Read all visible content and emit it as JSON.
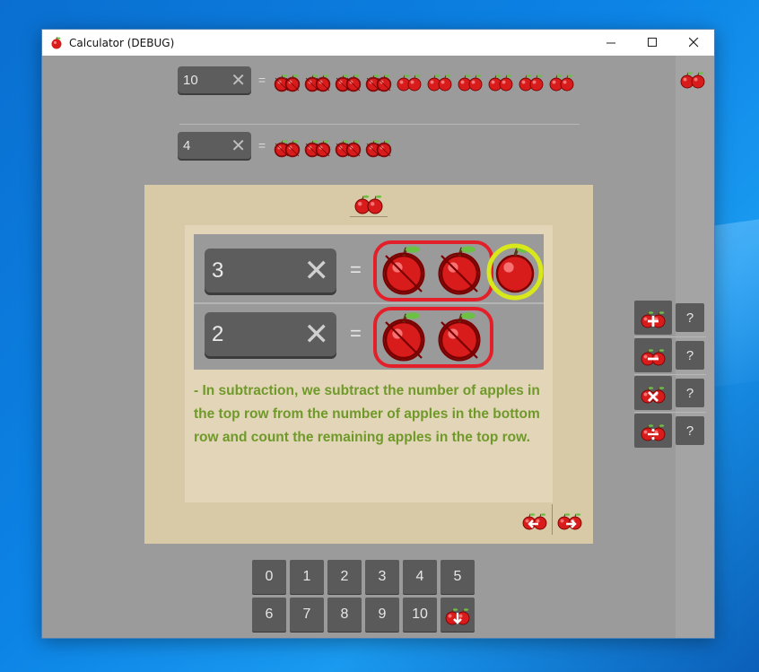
{
  "window": {
    "title": "Calculator (DEBUG)"
  },
  "top_rows": [
    {
      "value": "10",
      "apples": 10,
      "crossed": 4
    },
    {
      "value": "4",
      "apples": 4,
      "crossed": 4
    }
  ],
  "example": {
    "rows": [
      {
        "value": "3",
        "apples": 3,
        "crossed": 2
      },
      {
        "value": "2",
        "apples": 2,
        "crossed": 2
      }
    ],
    "equals": "=",
    "explanation": "- In subtraction, we subtract the number of apples in the top row from the number of apples in the bottom row and count the remaining apples in the top row."
  },
  "equals_sign": "=",
  "keypad": {
    "keys": [
      "0",
      "1",
      "2",
      "3",
      "4",
      "5",
      "6",
      "7",
      "8",
      "9",
      "10"
    ]
  },
  "operations": [
    {
      "name": "add",
      "help": "?"
    },
    {
      "name": "subtract",
      "help": "?"
    },
    {
      "name": "multiply",
      "help": "?"
    },
    {
      "name": "divide",
      "help": "?"
    }
  ],
  "colors": {
    "apple_red": "#d81c1c",
    "highlight_ring": "#d9e81a",
    "group_ring": "#e3202a",
    "explanation_text": "#6f9a2a",
    "panel_bg": "#d9caa7"
  }
}
